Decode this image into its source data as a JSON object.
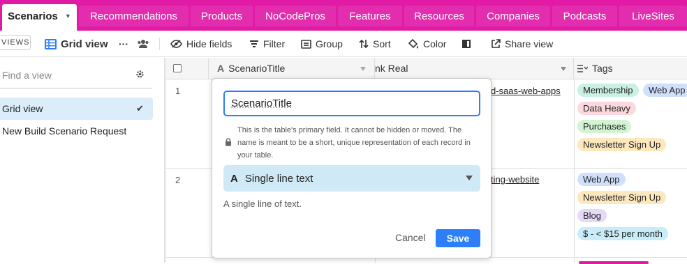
{
  "tabs": [
    {
      "label": "Scenarios",
      "active": true
    },
    {
      "label": "Recommendations"
    },
    {
      "label": "Products"
    },
    {
      "label": "NoCodePros"
    },
    {
      "label": "Features"
    },
    {
      "label": "Resources"
    },
    {
      "label": "Companies"
    },
    {
      "label": "Podcasts"
    },
    {
      "label": "LiveSites"
    }
  ],
  "toolbar": {
    "views_label": "VIEWS",
    "view_name": "Grid view",
    "more": "···",
    "hide_fields": "Hide fields",
    "filter": "Filter",
    "group": "Group",
    "sort": "Sort",
    "color": "Color",
    "share_view": "Share view"
  },
  "sidebar": {
    "find_placeholder": "Find a view",
    "views": [
      {
        "label": "Grid view",
        "selected": true
      },
      {
        "label": "New Build Scenario Request"
      }
    ]
  },
  "grid": {
    "columns": [
      "ScenarioTitle",
      "nk Real",
      "Tags"
    ],
    "rows": [
      {
        "num": "1",
        "link": "d-saas-web-apps",
        "tags": [
          {
            "label": "Membership",
            "color": "#c9f0e2"
          },
          {
            "label": "Web App",
            "color": "#d0e0fb"
          },
          {
            "label": "Data Heavy",
            "color": "#fbd8dd"
          },
          {
            "label": "Purchases",
            "color": "#d2f4d2"
          },
          {
            "label": "Newsletter Sign Up",
            "color": "#fde7bd"
          }
        ]
      },
      {
        "num": "2",
        "link": "ting-website",
        "tags": [
          {
            "label": "Web App",
            "color": "#d0e0fb"
          },
          {
            "label": "Newsletter Sign Up",
            "color": "#fde7bd"
          },
          {
            "label": "Blog",
            "color": "#e5d9f7"
          },
          {
            "label": "$ - < $15 per month",
            "color": "#c9ecf9"
          }
        ]
      }
    ]
  },
  "field_editor": {
    "field_name": "ScenarioTitle",
    "note": "This is the table's primary field. It cannot be hidden or moved. The name is meant to be a short, unique representation of each record in your table.",
    "type_label": "Single line text",
    "type_description": "A single line of text.",
    "cancel": "Cancel",
    "save": "Save"
  },
  "colors": {
    "brand": "#e11aa5",
    "primary_button": "#2d7ff9",
    "selected_view": "#dbedf9",
    "type_select": "#cfeaf6"
  }
}
